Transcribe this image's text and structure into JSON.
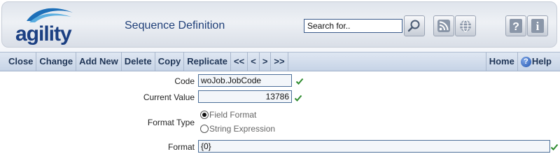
{
  "header": {
    "logo_text": "agility",
    "title": "Sequence Definition",
    "search": {
      "value": "Search for.."
    },
    "icons": [
      "search-icon",
      "rss-icon",
      "globe-icon",
      "help-icon",
      "info-icon"
    ]
  },
  "toolbar": {
    "items": [
      "Close",
      "Change",
      "Add New",
      "Delete",
      "Copy",
      "Replicate",
      "<<",
      "<",
      ">",
      ">>"
    ],
    "home": "Home",
    "help": "Help"
  },
  "form": {
    "code": {
      "label": "Code",
      "value": "woJob.JobCode"
    },
    "current_value": {
      "label": "Current Value",
      "value": "13786"
    },
    "format_type": {
      "label": "Format Type",
      "options": [
        "Field Format",
        "String Expression"
      ],
      "selected": "Field Format"
    },
    "format": {
      "label": "Format",
      "value": "{0}"
    }
  },
  "colors": {
    "brand": "#1b3f82",
    "toolbar_text": "#1f3556",
    "check": "#2e8b2e"
  }
}
